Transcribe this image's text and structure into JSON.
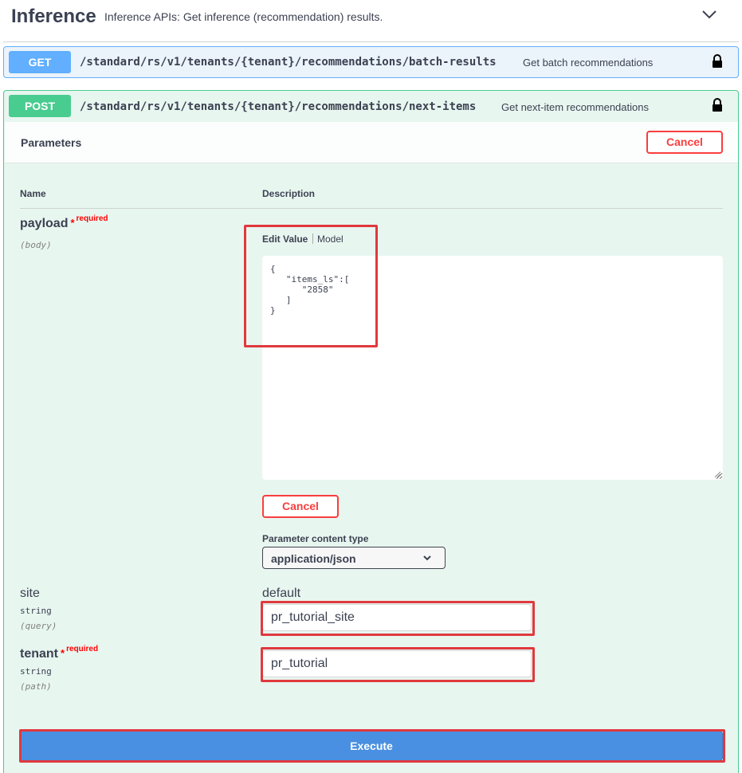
{
  "tag": {
    "title": "Inference",
    "description": "Inference APIs: Get inference (recommendation) results."
  },
  "operations": {
    "get": {
      "method": "GET",
      "path": "/standard/rs/v1/tenants/{tenant}/recommendations/batch-results",
      "summary": "Get batch recommendations"
    },
    "post": {
      "method": "POST",
      "path": "/standard/rs/v1/tenants/{tenant}/recommendations/next-items",
      "summary": "Get next-item recommendations"
    }
  },
  "parameters": {
    "title": "Parameters",
    "cancel_label": "Cancel",
    "col_name": "Name",
    "col_description": "Description",
    "payload": {
      "name": "payload",
      "star": "*",
      "required": "required",
      "location": "(body)",
      "tab_edit": "Edit Value",
      "tab_model": "Model",
      "value": "{\n   \"items_ls\":[\n      \"2858\"\n   ]\n}",
      "cancel_label": "Cancel",
      "content_type_label": "Parameter content type",
      "content_type": "application/json"
    },
    "site": {
      "name": "site",
      "type": "string",
      "location": "(query)",
      "default_label": "default",
      "value": "pr_tutorial_site"
    },
    "tenant": {
      "name": "tenant",
      "star": "*",
      "required": "required",
      "type": "string",
      "location": "(path)",
      "value": "pr_tutorial"
    }
  },
  "execute_label": "Execute",
  "colors": {
    "get": "#61affe",
    "post": "#49cc90",
    "cancel": "#f93e3e",
    "execute": "#4990e2",
    "highlight": "#e0393e"
  },
  "icons": [
    "chevron-down-icon",
    "lock-icon",
    "select-chevron-icon",
    "resize-grip-icon"
  ]
}
